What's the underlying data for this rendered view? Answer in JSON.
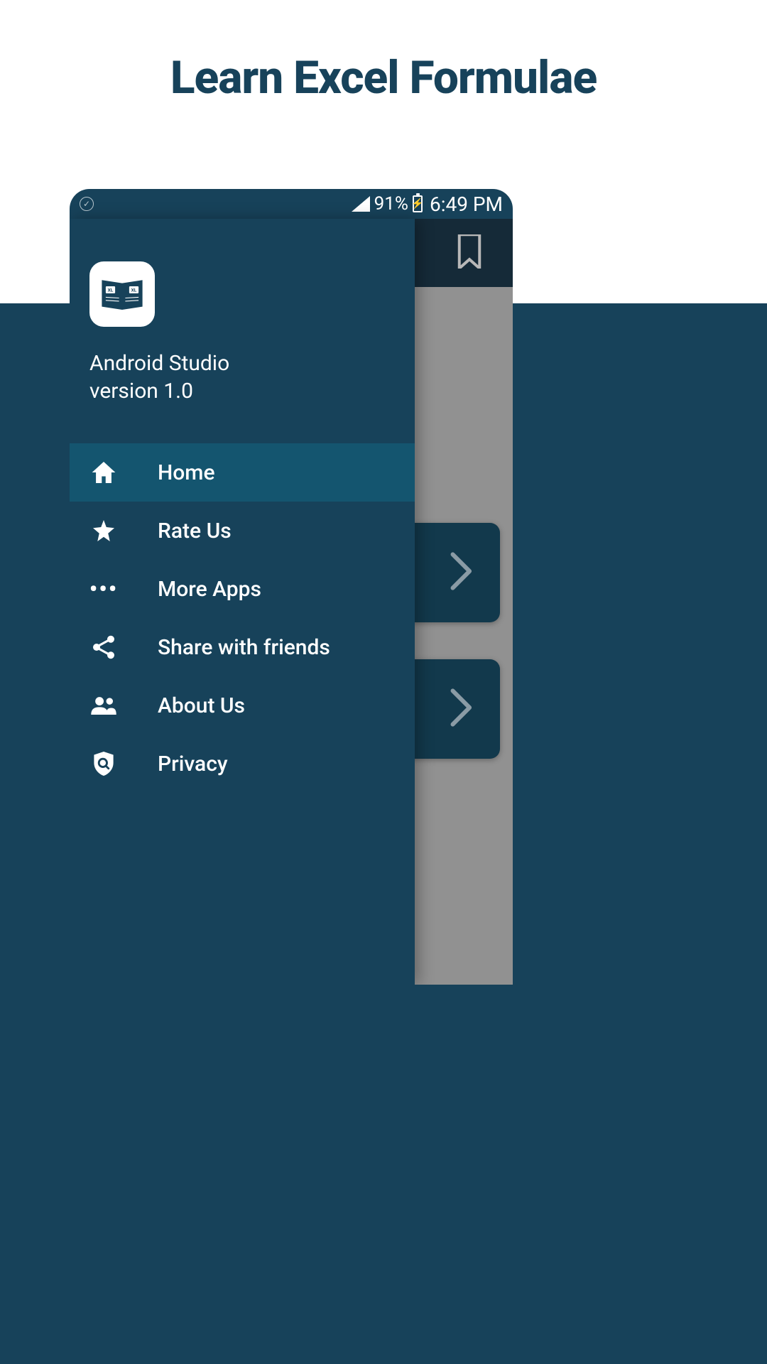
{
  "page": {
    "title": "Learn Excel Formulae"
  },
  "statusBar": {
    "battery": "91%",
    "time": "6:49 PM"
  },
  "drawer": {
    "appName": "Android Studio",
    "version": "version 1.0",
    "items": [
      {
        "label": "Home",
        "icon": "home",
        "active": true
      },
      {
        "label": "Rate Us",
        "icon": "star",
        "active": false
      },
      {
        "label": "More Apps",
        "icon": "dots",
        "active": false
      },
      {
        "label": "Share with friends",
        "icon": "share",
        "active": false
      },
      {
        "label": "About Us",
        "icon": "people",
        "active": false
      },
      {
        "label": "Privacy",
        "icon": "shield",
        "active": false
      }
    ]
  }
}
